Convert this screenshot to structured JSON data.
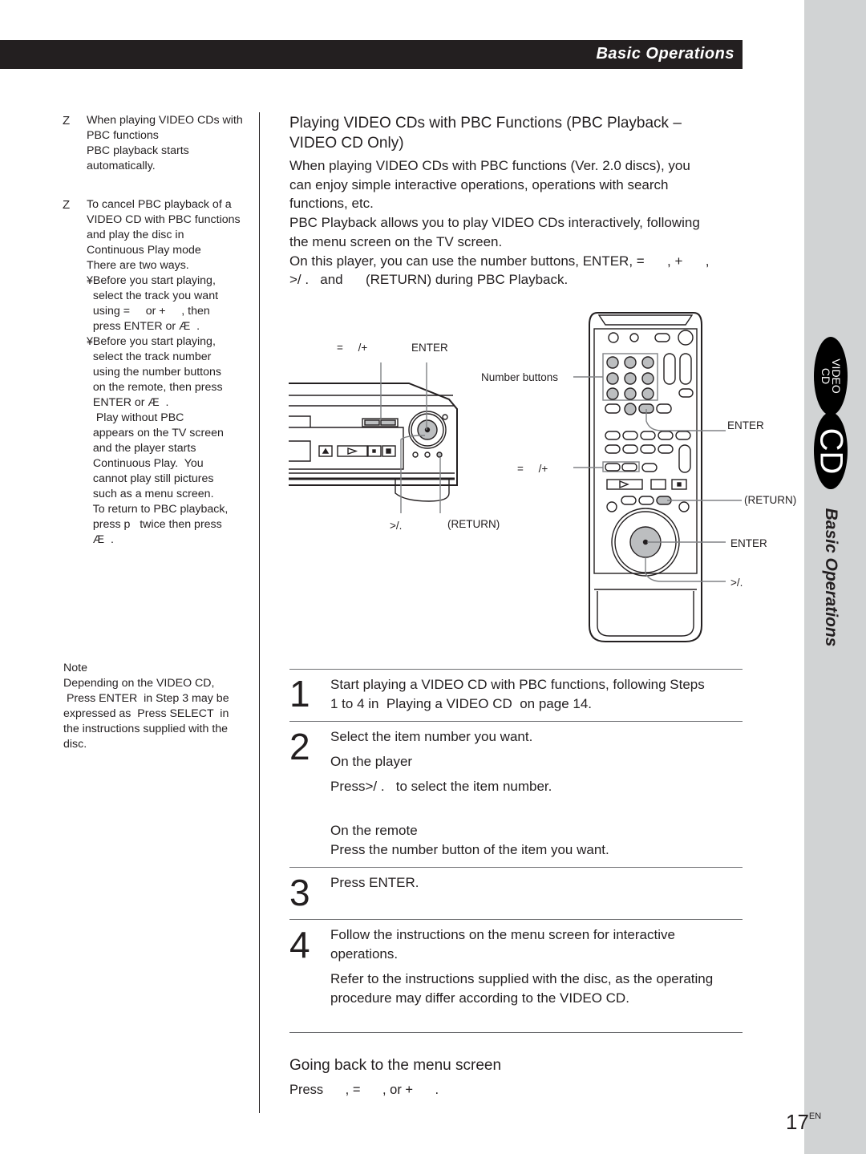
{
  "header": {
    "section_title": "Basic Operations"
  },
  "sidebar": {
    "tab_badges": [
      "VIDEO\nCD",
      "CD"
    ],
    "tab_label": "Basic Operations"
  },
  "tips": [
    {
      "bullet": "Z",
      "lines": [
        "When playing VIDEO CDs with",
        "PBC functions",
        "PBC playback starts",
        "automatically."
      ]
    },
    {
      "bullet": "Z",
      "lines": [
        "To cancel PBC playback of a",
        "VIDEO CD with PBC functions",
        "and play the disc in",
        "Continuous Play mode",
        "There are two ways."
      ],
      "sub_items": [
        {
          "lines": [
            "¥Before you start playing,",
            "  select the track you want",
            "  using =     or +     , then",
            "  press ENTER or Æ  ."
          ]
        },
        {
          "lines": [
            "¥Before you start playing,",
            "  select the track number",
            "  using the number buttons",
            "  on the remote, then press",
            "  ENTER or Æ  .",
            "   Play without PBC",
            "  appears on the TV screen",
            "  and the player starts",
            "  Continuous Play.  You",
            "  cannot play still pictures",
            "  such as a menu screen.",
            "  To return to PBC playback,",
            "  press p   twice then press",
            "  Æ  ."
          ]
        }
      ]
    }
  ],
  "note": {
    "title": "Note",
    "lines": [
      "Depending on the VIDEO CD,",
      " Press ENTER  in Step 3 may be",
      "expressed as  Press SELECT  in",
      "the instructions supplied with the",
      "disc."
    ]
  },
  "main": {
    "title_lines": [
      "Playing VIDEO CDs with PBC Functions (PBC Playback –",
      "VIDEO CD Only)"
    ],
    "intro_lines": [
      "When playing VIDEO CDs with PBC functions (Ver. 2.0 discs), you",
      "can enjoy simple interactive operations, operations with search",
      "functions, etc.",
      "PBC Playback allows you to play VIDEO CDs interactively, following",
      "the menu screen on the TV screen.",
      "On this player, you can use the number buttons, ENTER, =      , +      ,",
      ">/ .   and      (RETURN) during PBC Playback."
    ]
  },
  "diagram": {
    "player_labels": {
      "prev_next": "=     /+",
      "enter": "ENTER",
      "jog": ">/.",
      "return": "(RETURN)"
    },
    "remote_labels": {
      "number_buttons": "Number buttons",
      "enter_top": "ENTER",
      "prev_next": "=     /+",
      "return": "(RETURN)",
      "enter_jog": "ENTER",
      "jog": ">/."
    }
  },
  "steps": [
    {
      "number": "1",
      "lines": [
        "Start playing a VIDEO CD with PBC functions, following Steps",
        "1 to 4 in  Playing a VIDEO CD  on page 14."
      ]
    },
    {
      "number": "2",
      "lines": [
        "Select the item number you want."
      ],
      "player_head": "On the player",
      "player_text": "Press>/ .   to select the item number.",
      "remote_head": "On the remote",
      "remote_text": "Press the number button of the item you want."
    },
    {
      "number": "3",
      "lines": [
        "Press ENTER."
      ]
    },
    {
      "number": "4",
      "lines": [
        "Follow the instructions on the menu screen for interactive",
        "operations."
      ],
      "extra_lines": [
        "Refer to the instructions supplied with the disc, as the operating",
        "procedure may differ according to the VIDEO CD."
      ]
    }
  ],
  "going_back": {
    "title": "Going back to the menu screen",
    "text": "Press      , =      , or +      ."
  },
  "page": {
    "number": "17",
    "suffix": "EN"
  }
}
